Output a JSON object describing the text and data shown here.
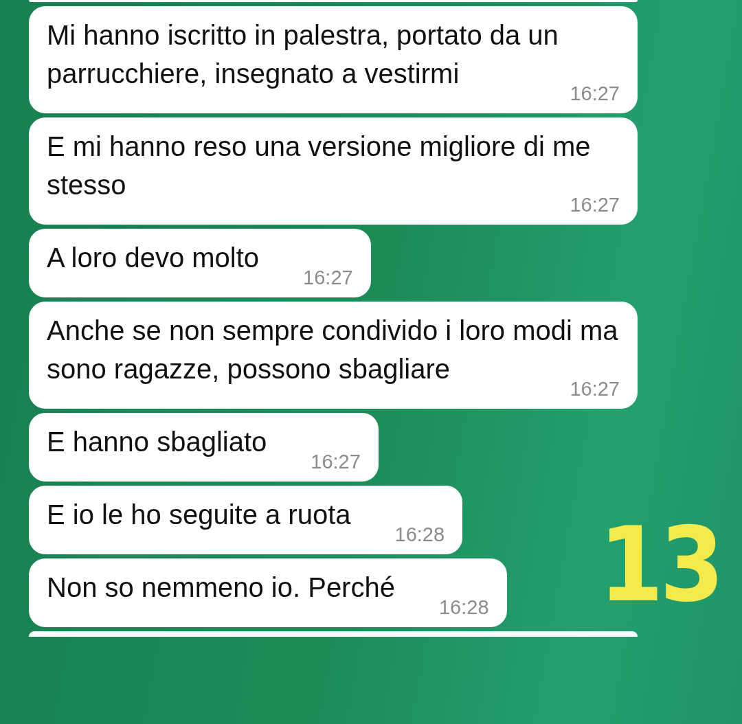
{
  "messages": [
    {
      "text": "Mi hanno iscritto in palestra, portato da un parrucchiere, insegnato a vestirmi",
      "time": "16:27"
    },
    {
      "text": "E mi hanno reso una versione migliore di me stesso",
      "time": "16:27"
    },
    {
      "text": "A loro devo molto",
      "time": "16:27"
    },
    {
      "text": "Anche se non sempre condivido i loro modi ma sono ragazze, possono sbagliare",
      "time": "16:27"
    },
    {
      "text": "E hanno sbagliato",
      "time": "16:27"
    },
    {
      "text": "E io le ho seguite a ruota",
      "time": "16:28"
    },
    {
      "text": "Non so nemmeno io. Perché",
      "time": "16:28"
    }
  ],
  "annotation": "13"
}
